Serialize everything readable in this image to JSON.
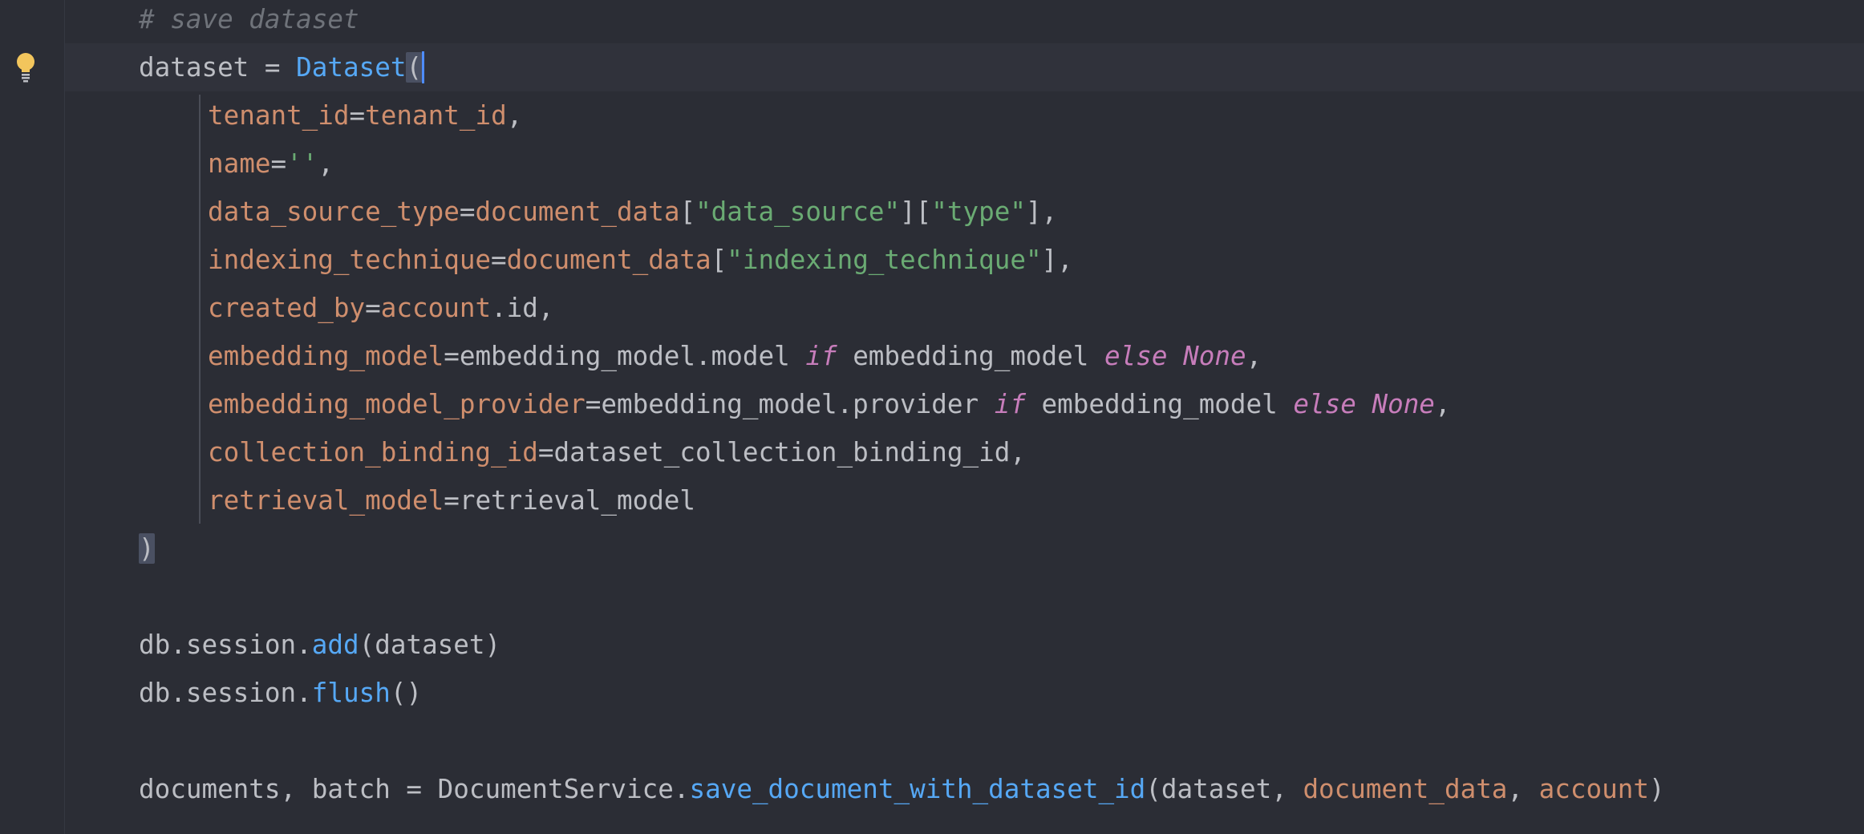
{
  "editor": {
    "lines": [
      {
        "id": "l0",
        "tokens": [
          {
            "t": "# save dataset",
            "c": "tok-comment"
          }
        ]
      },
      {
        "id": "l1",
        "current": true,
        "tokens": [
          {
            "t": "dataset = ",
            "c": "tok-ident"
          },
          {
            "t": "Dataset",
            "c": "tok-call"
          },
          {
            "t": "(",
            "c": "tok-punc tok-brace-hl"
          },
          {
            "caret": true
          }
        ]
      },
      {
        "id": "l2",
        "indent": true,
        "tokens": [
          {
            "t": "tenant_id",
            "c": "tok-param"
          },
          {
            "t": "=",
            "c": "tok-punc"
          },
          {
            "t": "tenant_id",
            "c": "tok-param"
          },
          {
            "t": ",",
            "c": "tok-punc"
          }
        ]
      },
      {
        "id": "l3",
        "indent": true,
        "tokens": [
          {
            "t": "name",
            "c": "tok-param"
          },
          {
            "t": "=",
            "c": "tok-punc"
          },
          {
            "t": "''",
            "c": "tok-str"
          },
          {
            "t": ",",
            "c": "tok-punc"
          }
        ]
      },
      {
        "id": "l4",
        "indent": true,
        "tokens": [
          {
            "t": "data_source_type",
            "c": "tok-param"
          },
          {
            "t": "=",
            "c": "tok-punc"
          },
          {
            "t": "document_data",
            "c": "tok-param"
          },
          {
            "t": "[",
            "c": "tok-punc"
          },
          {
            "t": "\"data_source\"",
            "c": "tok-str"
          },
          {
            "t": "][",
            "c": "tok-punc"
          },
          {
            "t": "\"type\"",
            "c": "tok-str"
          },
          {
            "t": "],",
            "c": "tok-punc"
          }
        ]
      },
      {
        "id": "l5",
        "indent": true,
        "tokens": [
          {
            "t": "indexing_technique",
            "c": "tok-param"
          },
          {
            "t": "=",
            "c": "tok-punc"
          },
          {
            "t": "document_data",
            "c": "tok-param"
          },
          {
            "t": "[",
            "c": "tok-punc"
          },
          {
            "t": "\"indexing_technique\"",
            "c": "tok-str"
          },
          {
            "t": "],",
            "c": "tok-punc"
          }
        ]
      },
      {
        "id": "l6",
        "indent": true,
        "tokens": [
          {
            "t": "created_by",
            "c": "tok-param"
          },
          {
            "t": "=",
            "c": "tok-punc"
          },
          {
            "t": "account",
            "c": "tok-param"
          },
          {
            "t": ".id,",
            "c": "tok-ident"
          }
        ]
      },
      {
        "id": "l7",
        "indent": true,
        "tokens": [
          {
            "t": "embedding_model",
            "c": "tok-param"
          },
          {
            "t": "=embedding_model.model ",
            "c": "tok-ident"
          },
          {
            "t": "if",
            "c": "tok-kw"
          },
          {
            "t": " embedding_model ",
            "c": "tok-ident"
          },
          {
            "t": "else",
            "c": "tok-kw"
          },
          {
            "t": " ",
            "c": "tok-ident"
          },
          {
            "t": "None",
            "c": "tok-kw"
          },
          {
            "t": ",",
            "c": "tok-punc"
          }
        ]
      },
      {
        "id": "l8",
        "indent": true,
        "tokens": [
          {
            "t": "embedding_model_provider",
            "c": "tok-param"
          },
          {
            "t": "=embedding_model.provider ",
            "c": "tok-ident"
          },
          {
            "t": "if",
            "c": "tok-kw"
          },
          {
            "t": " embedding_model ",
            "c": "tok-ident"
          },
          {
            "t": "else",
            "c": "tok-kw"
          },
          {
            "t": " ",
            "c": "tok-ident"
          },
          {
            "t": "None",
            "c": "tok-kw"
          },
          {
            "t": ",",
            "c": "tok-punc"
          }
        ]
      },
      {
        "id": "l9",
        "indent": true,
        "tokens": [
          {
            "t": "collection_binding_id",
            "c": "tok-param"
          },
          {
            "t": "=dataset_collection_binding_id,",
            "c": "tok-ident"
          }
        ]
      },
      {
        "id": "l10",
        "indent": true,
        "tokens": [
          {
            "t": "retrieval_model",
            "c": "tok-param"
          },
          {
            "t": "=retrieval_model",
            "c": "tok-ident"
          }
        ]
      },
      {
        "id": "l11",
        "tokens": [
          {
            "t": ")",
            "c": "tok-punc tok-brace-hl"
          }
        ]
      },
      {
        "id": "l12",
        "tokens": []
      },
      {
        "id": "l13",
        "tokens": [
          {
            "t": "db.session.",
            "c": "tok-ident"
          },
          {
            "t": "add",
            "c": "tok-call"
          },
          {
            "t": "(dataset)",
            "c": "tok-ident"
          }
        ]
      },
      {
        "id": "l14",
        "tokens": [
          {
            "t": "db.session.",
            "c": "tok-ident"
          },
          {
            "t": "flush",
            "c": "tok-call"
          },
          {
            "t": "()",
            "c": "tok-ident"
          }
        ]
      },
      {
        "id": "l15",
        "tokens": []
      },
      {
        "id": "l16",
        "tokens": [
          {
            "t": "documents, batch = DocumentService.",
            "c": "tok-ident"
          },
          {
            "t": "save_document_with_dataset_id",
            "c": "tok-call"
          },
          {
            "t": "(dataset, ",
            "c": "tok-ident"
          },
          {
            "t": "document_data",
            "c": "tok-param"
          },
          {
            "t": ", ",
            "c": "tok-ident"
          },
          {
            "t": "account",
            "c": "tok-param"
          },
          {
            "t": ")",
            "c": "tok-ident"
          }
        ]
      }
    ]
  },
  "gutter": {
    "icon": "lightbulb-icon"
  }
}
